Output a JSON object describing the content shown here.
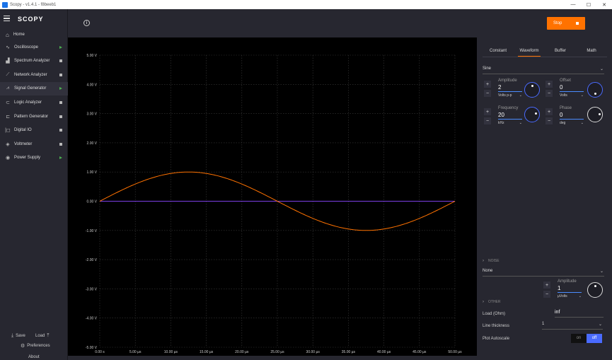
{
  "window": {
    "title": "Scopy - v1.4.1 - f8beeb1",
    "controls": [
      "—",
      "☐",
      "✕"
    ]
  },
  "sidebar": {
    "logo": "SCOPY",
    "home_label": "Home",
    "items": [
      {
        "label": "Oscilloscope",
        "icon": "oscilloscope-icon",
        "glyph": "∿",
        "status": "run"
      },
      {
        "label": "Spectrum Analyzer",
        "icon": "spectrum-icon",
        "glyph": "▟",
        "status": "idle"
      },
      {
        "label": "Network Analyzer",
        "icon": "network-icon",
        "glyph": "⟋",
        "status": "idle"
      },
      {
        "label": "Signal Generator",
        "icon": "signal-generator-icon",
        "glyph": "⩘",
        "status": "run",
        "active": true
      },
      {
        "label": "Logic Analyzer",
        "icon": "logic-icon",
        "glyph": "⊂",
        "status": "idle"
      },
      {
        "label": "Pattern Generator",
        "icon": "pattern-icon",
        "glyph": "⊏",
        "status": "idle"
      },
      {
        "label": "Digital IO",
        "icon": "digital-io-icon",
        "glyph": "|◻",
        "status": "idle"
      },
      {
        "label": "Voltmeter",
        "icon": "voltmeter-icon",
        "glyph": "◈",
        "status": "idle"
      },
      {
        "label": "Power Supply",
        "icon": "power-supply-icon",
        "glyph": "◉",
        "status": "run"
      }
    ],
    "save_label": "Save",
    "load_label": "Load",
    "preferences_label": "Preferences",
    "about_label": "About"
  },
  "toolbar": {
    "stop_label": "Stop"
  },
  "plot": {
    "y_ticks": [
      "5.00 V",
      "4.00 V",
      "3.00 V",
      "2.00 V",
      "1.00 V",
      "0.00 V",
      "-1.00 V",
      "-2.00 V",
      "-3.00 V",
      "-4.00 V",
      "-5.00 V"
    ],
    "x_ticks": [
      "0.00 s",
      "5.00 µs",
      "10.00 µs",
      "15.00 µs",
      "20.00 µs",
      "25.00 µs",
      "30.00 µs",
      "35.00 µs",
      "40.00 µs",
      "45.00 µs",
      "50.00 µs"
    ],
    "colors": {
      "signal": "#ff7200",
      "baseline": "#7b3fe4",
      "grid": "#3a3a3a",
      "background": "#000000"
    }
  },
  "chart_data": {
    "type": "line",
    "x_unit": "µs",
    "y_unit": "V",
    "xlim": [
      0,
      50
    ],
    "ylim": [
      -5,
      5
    ],
    "grid": true,
    "series": [
      {
        "kind": "sine",
        "amplitude_peak": 1,
        "period_us": 50,
        "phase_deg": 0,
        "offset": 0,
        "color": "#ff7200"
      },
      {
        "kind": "constant",
        "value": 0,
        "color": "#7b3fe4"
      }
    ]
  },
  "panel": {
    "tabs": [
      "Constant",
      "Waveform",
      "Buffer",
      "Math"
    ],
    "selected_tab": 1,
    "waveform_type": "Sine",
    "amplitude": {
      "label": "Amplitude",
      "value": "2",
      "unit": "Volts p-p"
    },
    "offset": {
      "label": "Offset",
      "value": "0",
      "unit": "Volts"
    },
    "frequency": {
      "label": "Frequency",
      "value": "20",
      "unit": "kHz"
    },
    "phase": {
      "label": "Phase",
      "value": "0",
      "unit": "deg"
    },
    "noise": {
      "section": "NOISE",
      "type": "None",
      "amplitude_label": "Amplitude",
      "amplitude_value": "1",
      "amplitude_unit": "µVolts"
    },
    "other": {
      "section": "OTHER",
      "load_label": "Load (Ohm)",
      "load_value": "inf",
      "line_thickness_label": "Line thickness",
      "line_thickness_value": "1",
      "autoscale_label": "Plot Autoscale",
      "toggle_on": "on",
      "toggle_off": "off"
    },
    "plus": "+",
    "minus": "−",
    "chevron": "⌄"
  }
}
